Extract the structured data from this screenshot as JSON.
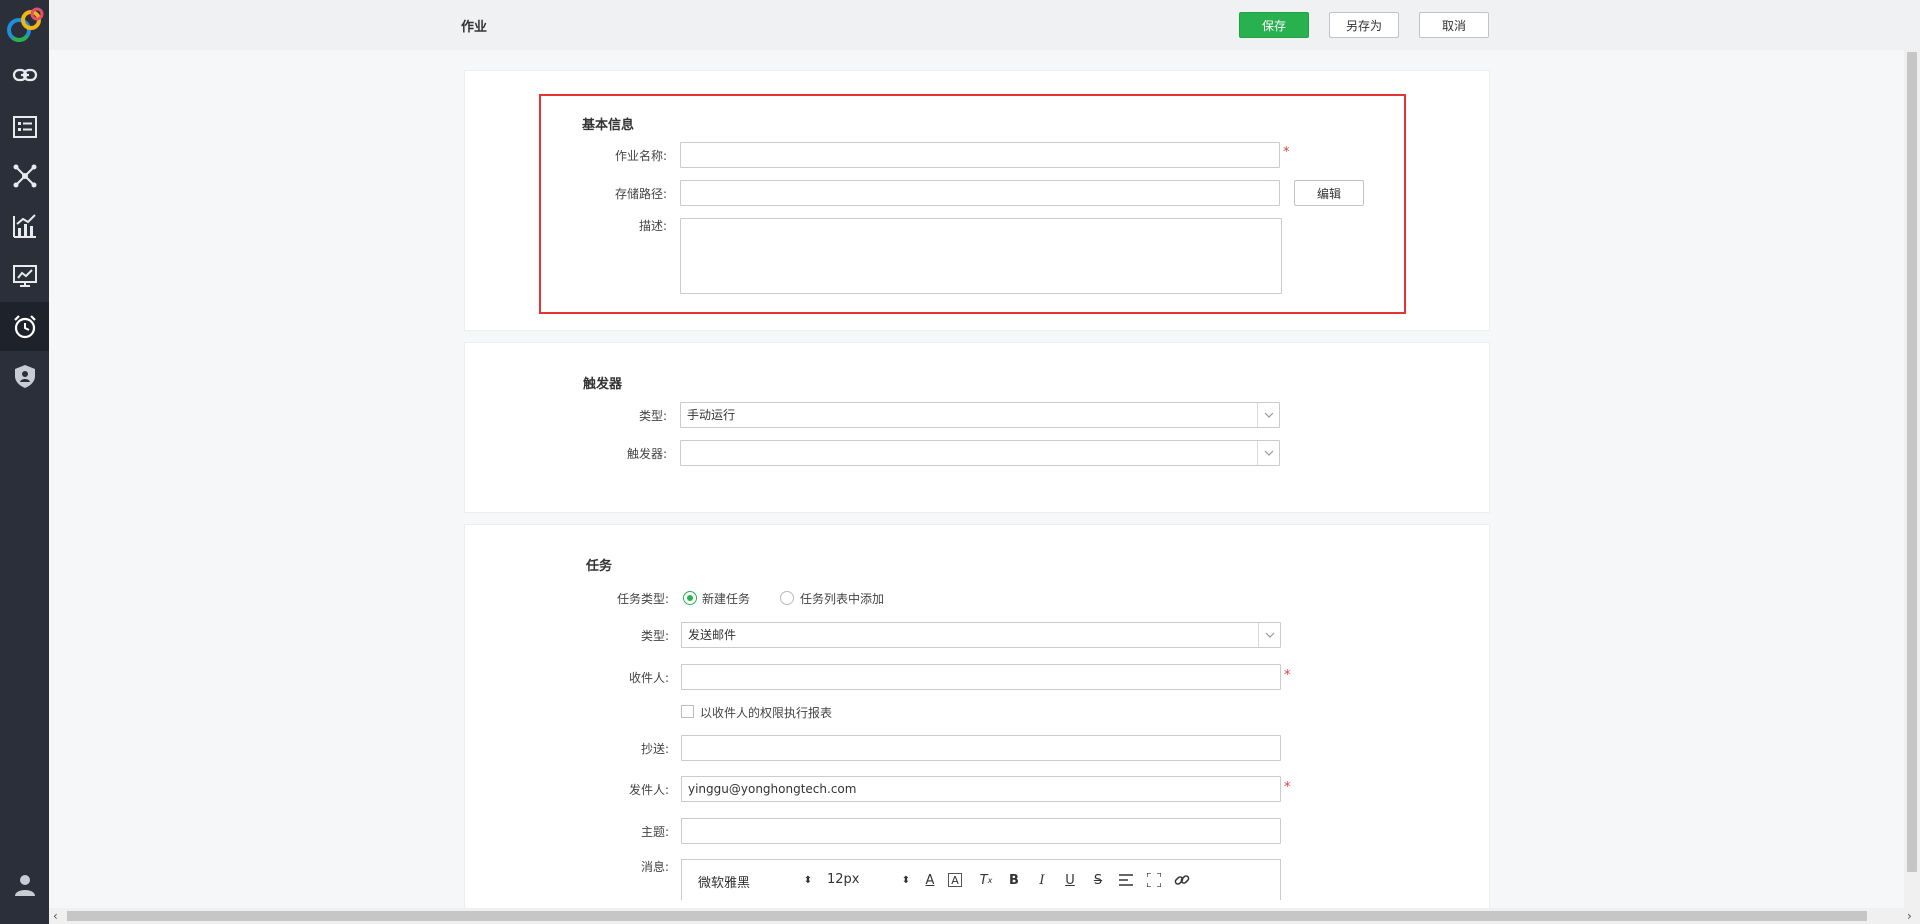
{
  "header": {
    "title": "作业",
    "save_label": "保存",
    "save_as_label": "另存为",
    "cancel_label": "取消"
  },
  "sidebar": {
    "items": [
      {
        "icon": "link-icon"
      },
      {
        "icon": "list-icon"
      },
      {
        "icon": "network-icon"
      },
      {
        "icon": "chart-icon"
      },
      {
        "icon": "dashboard-icon"
      },
      {
        "icon": "alarm-clock-icon",
        "active": true
      },
      {
        "icon": "shield-user-icon"
      },
      {
        "icon": "user-icon"
      }
    ]
  },
  "basic_info": {
    "title": "基本信息",
    "name_label": "作业名称:",
    "name_value": "",
    "path_label": "存储路径:",
    "path_value": "",
    "edit_label": "编辑",
    "desc_label": "描述:",
    "desc_value": ""
  },
  "trigger": {
    "title": "触发器",
    "type_label": "类型:",
    "type_value": "手动运行",
    "trigger_label": "触发器:",
    "trigger_value": ""
  },
  "task": {
    "title": "任务",
    "task_type_label": "任务类型:",
    "option_new": "新建任务",
    "option_from_list": "任务列表中添加",
    "type_label": "类型:",
    "type_value": "发送邮件",
    "recipient_label": "收件人:",
    "recipient_value": "",
    "run_as_recipient_label": "以收件人的权限执行报表",
    "cc_label": "抄送:",
    "cc_value": "",
    "sender_label": "发件人:",
    "sender_value": "yinggu@yonghongtech.com",
    "subject_label": "主题:",
    "subject_value": "",
    "message_label": "消息:",
    "editor": {
      "font_family": "微软雅黑",
      "font_size": "12px"
    }
  },
  "required_mark": "*",
  "colors": {
    "primary": "#2ab14f",
    "sidebar_bg": "#2a2f3a",
    "highlight": "#e53232",
    "required": "#e03c3c"
  }
}
